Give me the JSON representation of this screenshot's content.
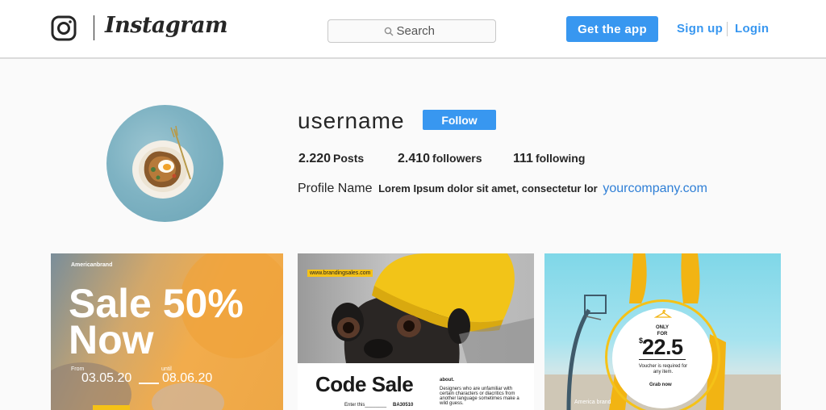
{
  "header": {
    "logo_icon": "instagram-camera-icon",
    "wordmark": "Instagram",
    "search": {
      "placeholder": "Search",
      "icon": "search-icon"
    },
    "get_app_label": "Get the app",
    "signup_label": "Sign up",
    "login_label": "Login"
  },
  "profile": {
    "username": "username",
    "follow_label": "Follow",
    "stats": {
      "posts": {
        "count": "2.220",
        "label": "Posts"
      },
      "followers": {
        "count": "2.410",
        "label": "followers"
      },
      "following": {
        "count": "111",
        "label": "following"
      }
    },
    "bio": {
      "name": "Profile Name",
      "text": "Lorem Ipsum dolor sit amet, consectetur lor",
      "link": "yourcompany.com"
    }
  },
  "posts": [
    {
      "brand": "Americanbrand",
      "title_line1": "Sale 50%",
      "title_line2": "Now",
      "from_label": "From",
      "until_label": "until",
      "from_date": "03.05.20",
      "until_date": "08.06.20"
    },
    {
      "url": "www.brandingsales.com",
      "title": "Code Sale",
      "about_label": "about.",
      "description": "Designers who are unfamiliar with certain characters or diacritics from another language sometimes make a wild guess.",
      "enter_label": "Enter this________",
      "code": "BA30510"
    },
    {
      "only_for": "ONLY FOR",
      "currency": "$",
      "price": "22.5",
      "voucher_text": "Voucher is required for any item.",
      "grab_label": "Grab now",
      "brand": "America brand"
    }
  ],
  "colors": {
    "accent": "#3897f0",
    "link": "#2f7fd6",
    "highlight": "#f5c217",
    "border": "#dbdbdb"
  }
}
